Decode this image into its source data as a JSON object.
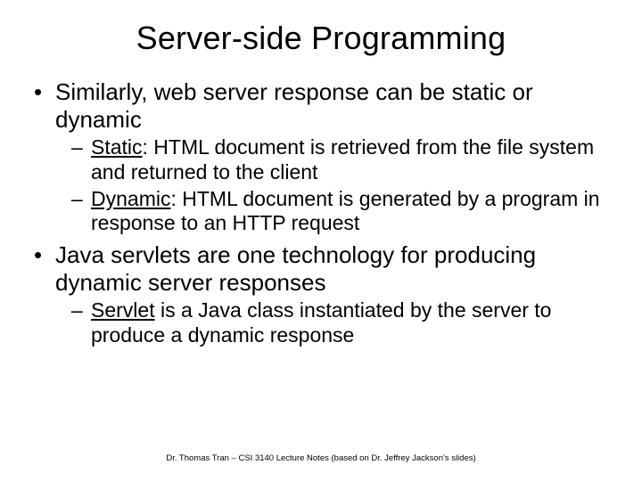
{
  "title": "Server-side Programming",
  "bullets": {
    "b1": {
      "text": "Similarly, web server response can be static or dynamic",
      "sub": {
        "s1": {
          "label": "Static",
          "rest": ": HTML document is retrieved from the file system and returned to the client"
        },
        "s2": {
          "label": "Dynamic",
          "rest": ": HTML document is generated by a program in response to an HTTP request"
        }
      }
    },
    "b2": {
      "text": "Java servlets are one technology for producing dynamic server responses",
      "sub": {
        "s1": {
          "label": "Servlet",
          "rest": " is a Java class instantiated by the server to produce a dynamic response"
        }
      }
    }
  },
  "footer": "Dr. Thomas Tran – CSI 3140 Lecture Notes (based on Dr. Jeffrey Jackson's slides)"
}
